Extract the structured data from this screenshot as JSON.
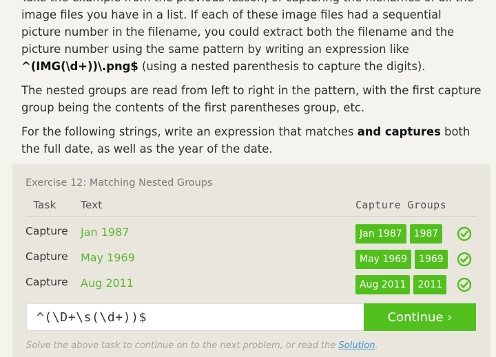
{
  "lesson": {
    "para1": {
      "text_a": "Take the example from the previous lesson, of capturing the filenames of all the image files you have in a list. If each of these image files had a sequential picture number in the filename, you could extract both the filename and the picture number using the same pattern by writing an expression like ",
      "code": "^(IMG(\\d+))\\.png$",
      "text_b": " (using a nested parenthesis to capture the digits)."
    },
    "para2": "The nested groups are read from left to right in the pattern, with the first capture group being the contents of the first parentheses group, etc.",
    "para3": {
      "text_a": "For the following strings, write an expression that matches ",
      "bold": "and captures",
      "text_b": " both the full date, as well as the year of the date."
    }
  },
  "exercise": {
    "title": "Exercise 12: Matching Nested Groups",
    "headers": {
      "task": "Task",
      "text": "Text",
      "capture_groups": "Capture Groups"
    },
    "rows": [
      {
        "task": "Capture",
        "text": "Jan 1987",
        "groups": [
          "Jan 1987",
          "1987"
        ],
        "status": "check-icon"
      },
      {
        "task": "Capture",
        "text": "May 1969",
        "groups": [
          "May 1969",
          "1969"
        ],
        "status": "check-icon"
      },
      {
        "task": "Capture",
        "text": "Aug 2011",
        "groups": [
          "Aug 2011",
          "2011"
        ],
        "status": "check-icon"
      }
    ],
    "input_value": "^(\\D+\\s(\\d+))$",
    "continue_label": "Continue ›",
    "footer": {
      "text": "Solve the above task to continue on to the next problem, or read the ",
      "link": "Solution",
      "end": "."
    }
  },
  "colors": {
    "accent": "#52c01c",
    "match_text": "#5cb82f",
    "panel": "#e9e6dd",
    "background": "#f5f3ee"
  }
}
